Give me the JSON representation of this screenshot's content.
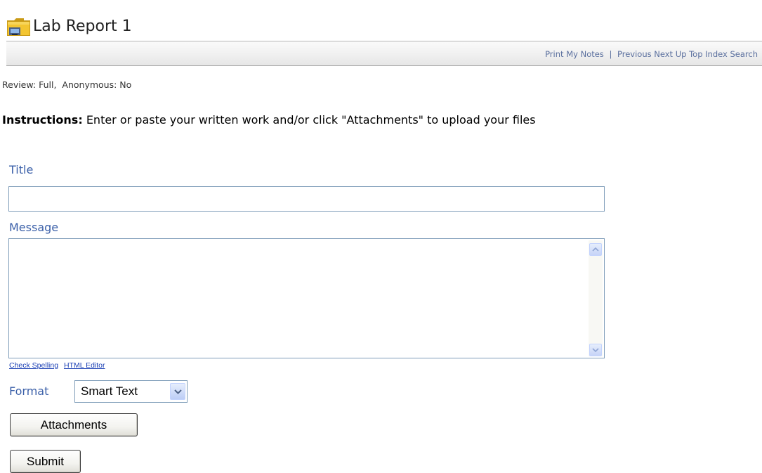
{
  "header": {
    "title": "Lab Report 1",
    "icon": "folder-icon"
  },
  "nav": {
    "print": "Print",
    "my_notes": "My Notes",
    "separator": "|",
    "previous": "Previous",
    "next": "Next",
    "up": "Up",
    "top": "Top",
    "index": "Index",
    "search": "Search"
  },
  "review_line": "Review: Full,  Anonymous: No",
  "instructions": {
    "label": "Instructions:",
    "text": "Enter or paste your written work and/or click \"Attachments\" to upload your files"
  },
  "form": {
    "title_label": "Title",
    "title_value": "",
    "message_label": "Message",
    "message_value": "",
    "check_spelling": "Check Spelling",
    "html_editor": "HTML Editor",
    "format_label": "Format",
    "format_value": "Smart Text",
    "attachments_button": "Attachments",
    "submit_button": "Submit"
  },
  "colors": {
    "label_blue": "#3a5fa8",
    "link_blue": "#1a3fb4",
    "nav_link": "#5a6f9e",
    "input_border": "#7f9db9"
  }
}
